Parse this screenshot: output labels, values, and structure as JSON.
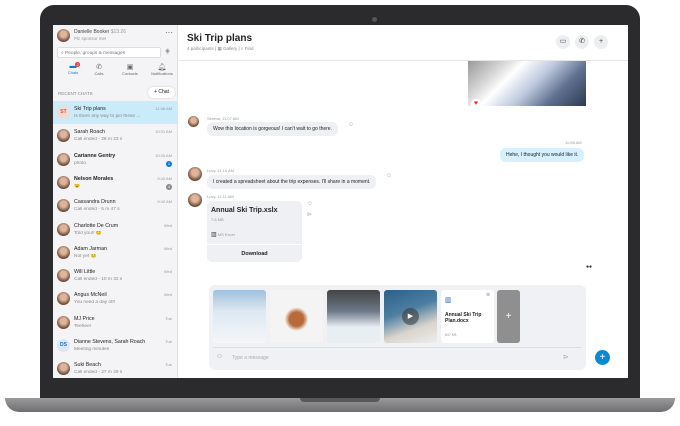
{
  "profile": {
    "name": "Danielle Booker",
    "credit": "$13.26",
    "status": "Plz sponsor me!"
  },
  "search": {
    "placeholder": "People, groups & messages"
  },
  "nav": [
    {
      "label": "Chats",
      "badge": "2"
    },
    {
      "label": "Calls"
    },
    {
      "label": "Contacts"
    },
    {
      "label": "Notifications"
    }
  ],
  "recent_label": "RECENT CHATS",
  "new_chat": "+ Chat",
  "chats": [
    {
      "initials": "ST",
      "name": "Ski Trip plans",
      "preview": "Is there any way to pin these ...",
      "time": "11:08 AM"
    },
    {
      "name": "Sarah Roach",
      "preview": "Call ended - 26 m 23 s",
      "time": "10:31 AM"
    },
    {
      "name": "Carianne Gentry",
      "preview": "photo",
      "time": "10:30 AM",
      "badge": "1"
    },
    {
      "name": "Nelson Morales",
      "preview": "😉",
      "time": "9:42 AM",
      "badge": "4"
    },
    {
      "name": "Cassandra Drunn",
      "preview": "Call ended - 5 m 47 s",
      "time": "9:42 AM"
    },
    {
      "name": "Charlotte De Crum",
      "preview": "Told you!! 😊",
      "time": "Wed"
    },
    {
      "name": "Adam Jarman",
      "preview": "Not yet 😐",
      "time": "Wed"
    },
    {
      "name": "Will Little",
      "preview": "Call ended - 10 m 32 s",
      "time": "Wed"
    },
    {
      "name": "Angus McNeil",
      "preview": "You need a day off!",
      "time": "Wed"
    },
    {
      "name": "MJ Price",
      "preview": "Teehee!",
      "time": "Tue"
    },
    {
      "initials": "DS",
      "name": "Dianne Stevens, Sarah Roach",
      "preview": "Meeting minutes",
      "time": "Tue"
    },
    {
      "name": "Suki Beach",
      "preview": "Call ended - 27 m 29 s",
      "time": "Tue"
    }
  ],
  "chat": {
    "title": "Ski Trip plans",
    "participants": "4 participants",
    "gallery": "Gallery",
    "find": "Find"
  },
  "messages": [
    {
      "meta": "Serena, 11:07 AM",
      "text": "Wow this location is gorgeous! I can't wait to go there."
    },
    {
      "meta": "11:08 AM",
      "text": "Hehe, I thought you would like it."
    },
    {
      "meta": "Lucy, 11:10 AM",
      "text": "I created a spreadsheet about the trip expenses. I'll share in a moment."
    },
    {
      "meta": "Lucy, 11:11 AM"
    }
  ],
  "file": {
    "name": "Annual Ski Trip.xslx",
    "size": "7.6 MB",
    "app": "MS Excel",
    "download": "Download"
  },
  "attachment": {
    "name": "Annual Ski Trip Plan.docx",
    "size": "847 KB"
  },
  "composer": {
    "placeholder": "Type a message"
  }
}
